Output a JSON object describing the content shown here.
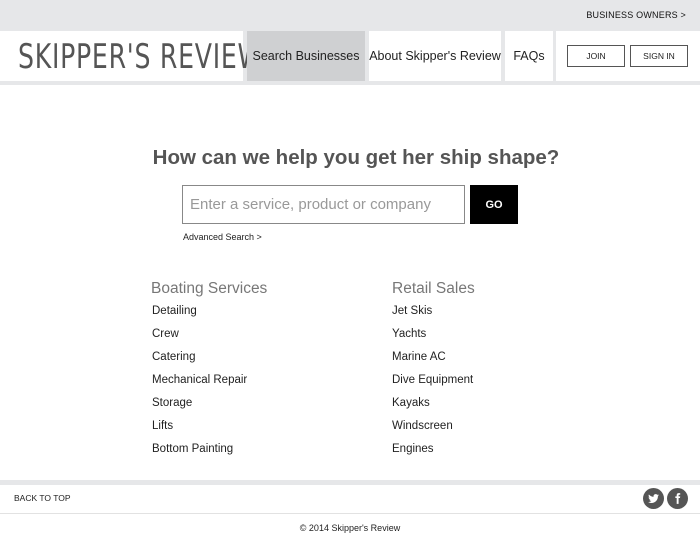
{
  "topbar": {
    "business_owners": "BUSINESS OWNERS >"
  },
  "header": {
    "logo": "SKIPPER'S REVIEW",
    "nav": [
      {
        "label": "Search Businesses",
        "active": true
      },
      {
        "label": "About Skipper's Review",
        "active": false
      },
      {
        "label": "FAQs",
        "active": false
      }
    ],
    "join": "JOIN",
    "sign_in": "SIGN IN"
  },
  "hero": {
    "headline": "How can we help you get her ship shape?",
    "search_placeholder": "Enter a service, product or company",
    "go": "GO",
    "advanced": "Advanced Search >"
  },
  "categories": {
    "boating": {
      "title": "Boating Services",
      "items": [
        "Detailing",
        "Crew",
        "Catering",
        "Mechanical Repair",
        "Storage",
        "Lifts",
        "Bottom Painting"
      ]
    },
    "retail": {
      "title": "Retail Sales",
      "items": [
        "Jet Skis",
        "Yachts",
        "Marine AC",
        "Dive Equipment",
        "Kayaks",
        "Windscreen",
        "Engines"
      ]
    }
  },
  "footer": {
    "back_to_top": "BACK TO TOP",
    "social": [
      "twitter-icon",
      "facebook-icon"
    ],
    "copyright": "© 2014 Skipper's Review"
  }
}
